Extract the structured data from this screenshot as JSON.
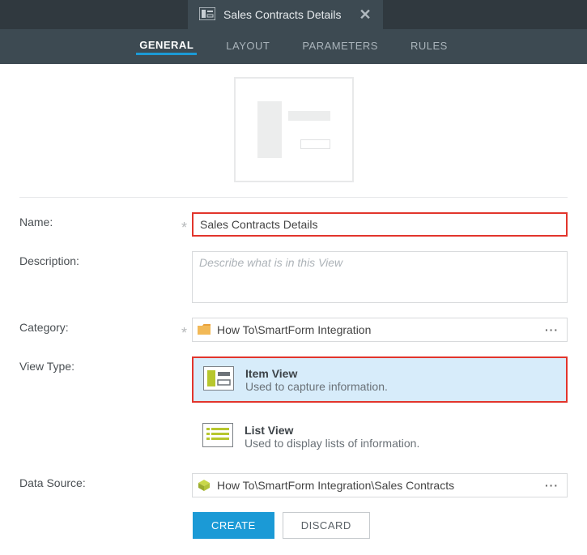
{
  "header": {
    "title": "Sales Contracts Details"
  },
  "tabs": {
    "general": "GENERAL",
    "layout": "LAYOUT",
    "parameters": "PARAMETERS",
    "rules": "RULES"
  },
  "labels": {
    "name": "Name:",
    "description": "Description:",
    "category": "Category:",
    "viewType": "View Type:",
    "dataSource": "Data Source:"
  },
  "fields": {
    "name": "Sales Contracts Details",
    "descriptionPlaceholder": "Describe what is in this View",
    "category": "How To\\SmartForm Integration",
    "dataSource": "How To\\SmartForm Integration\\Sales Contracts"
  },
  "viewTypes": {
    "item": {
      "title": "Item View",
      "subtitle": "Used to capture information."
    },
    "list": {
      "title": "List View",
      "subtitle": "Used to display lists of information."
    }
  },
  "buttons": {
    "create": "CREATE",
    "discard": "DISCARD"
  }
}
